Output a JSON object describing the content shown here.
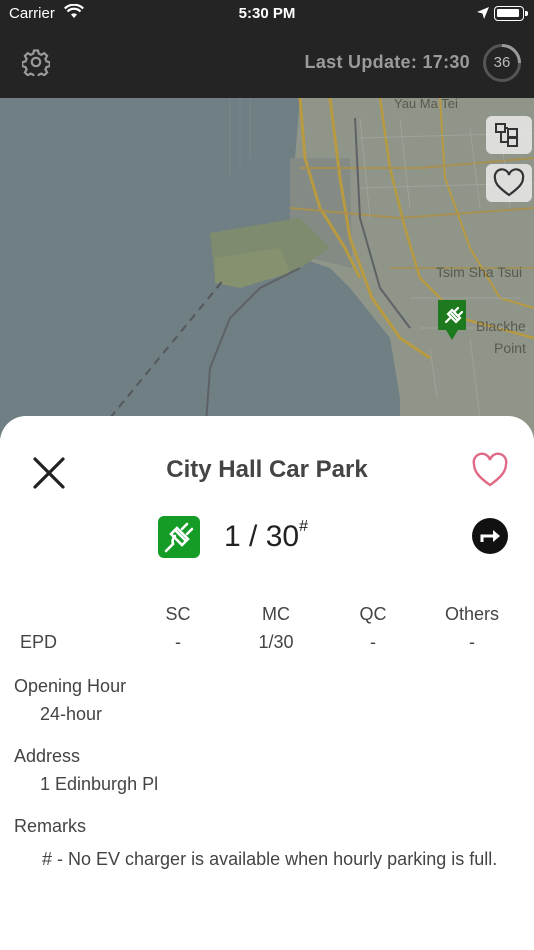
{
  "status_bar": {
    "carrier": "Carrier",
    "time": "5:30 PM"
  },
  "header": {
    "last_update": "Last Update: 17:30",
    "countdown": "36",
    "settings_icon": "gear-icon"
  },
  "map": {
    "labels": [
      "Yau Ma Tei",
      "Tsim Sha Tsui",
      "Blackhe",
      "Point"
    ],
    "layers_icon": "layers-icon",
    "favorites_icon": "heart-outline-icon",
    "marker_icon": "ev-plug-marker-icon",
    "marker_color": "#1e7a1e"
  },
  "detail": {
    "title": "City Hall Car Park",
    "available": "1 / 30",
    "footnote_mark": "#",
    "accent_color": "#149c26",
    "favorite_color": "#e06a86",
    "table": {
      "headers": [
        "SC",
        "MC",
        "QC",
        "Others"
      ],
      "rows": [
        {
          "label": "EPD",
          "values": [
            "-",
            "1/30",
            "-",
            "-"
          ]
        }
      ]
    },
    "opening_hour_label": "Opening Hour",
    "opening_hour": "24-hour",
    "address_label": "Address",
    "address": "1 Edinburgh Pl",
    "remarks_label": "Remarks",
    "remarks": "# - No EV charger is available when hourly parking is full."
  }
}
